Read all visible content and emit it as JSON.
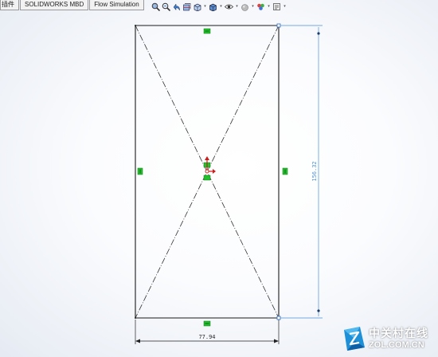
{
  "tabs": [
    {
      "label": "插件"
    },
    {
      "label": "SOLIDWORKS MBD"
    },
    {
      "label": "Flow Simulation"
    }
  ],
  "toolbar": {
    "icons": [
      "zoom-to-fit",
      "zoom-to-area",
      "previous-view",
      "section-view",
      "view-orientation",
      "display-style",
      "hide-show-items",
      "edit-appearance",
      "apply-scene",
      "view-settings"
    ]
  },
  "sketch": {
    "width_dimension": "77.94",
    "height_dimension": "156.32",
    "line_color": "#1a1a1a",
    "dimension_color": "#4a90d9",
    "relation_color": "#22c02c",
    "origin_color": "#d11a1a"
  },
  "watermark": {
    "cn_text": "中关村在线",
    "url": "ZOL.COM.CN"
  }
}
